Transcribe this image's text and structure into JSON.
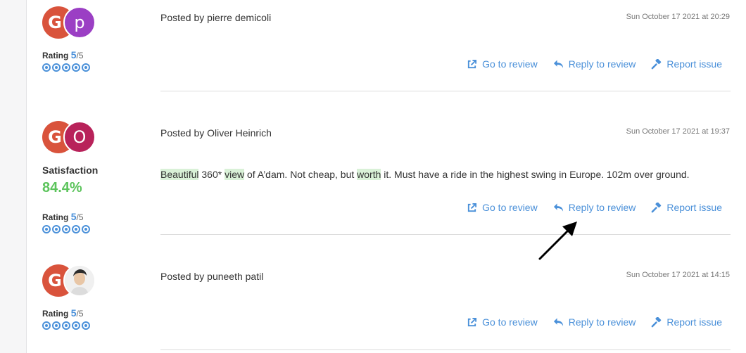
{
  "reviews": [
    {
      "badge_letter": "G",
      "user_initial": "p",
      "user_color": "#9b3fc4",
      "posted_by": "Posted by pierre demicoli",
      "date": "Sun October 17 2021 at 20:29",
      "rating_label": "Rating",
      "rating_value": "5",
      "rating_max": "/5",
      "actions": {
        "go": "Go to review",
        "reply": "Reply to review",
        "report": "Report issue"
      }
    },
    {
      "badge_letter": "G",
      "user_initial": "O",
      "user_color": "#b8225a",
      "posted_by": "Posted by Oliver Heinrich",
      "date": "Sun October 17 2021 at 19:37",
      "satisfaction_label": "Satisfaction",
      "satisfaction_value": "84.4%",
      "text_parts": [
        "Beautiful",
        " 360* ",
        "view",
        " of A’dam. Not cheap, but ",
        "worth",
        " it. Must have a ride in the highest swing in Europe. 102m over ground."
      ],
      "rating_label": "Rating",
      "rating_value": "5",
      "rating_max": "/5",
      "actions": {
        "go": "Go to review",
        "reply": "Reply to review",
        "report": "Report issue"
      }
    },
    {
      "badge_letter": "G",
      "user_initial": "",
      "user_color": "#ececec",
      "posted_by": "Posted by puneeth patil",
      "date": "Sun October 17 2021 at 14:15",
      "rating_label": "Rating",
      "rating_value": "5",
      "rating_max": "/5",
      "actions": {
        "go": "Go to review",
        "reply": "Reply to review",
        "report": "Report issue"
      }
    }
  ],
  "colors": {
    "accent": "#4a90d9",
    "satisfaction": "#5cc45c",
    "highlight": "#d9f1d7",
    "google_red": "#d9533c"
  }
}
